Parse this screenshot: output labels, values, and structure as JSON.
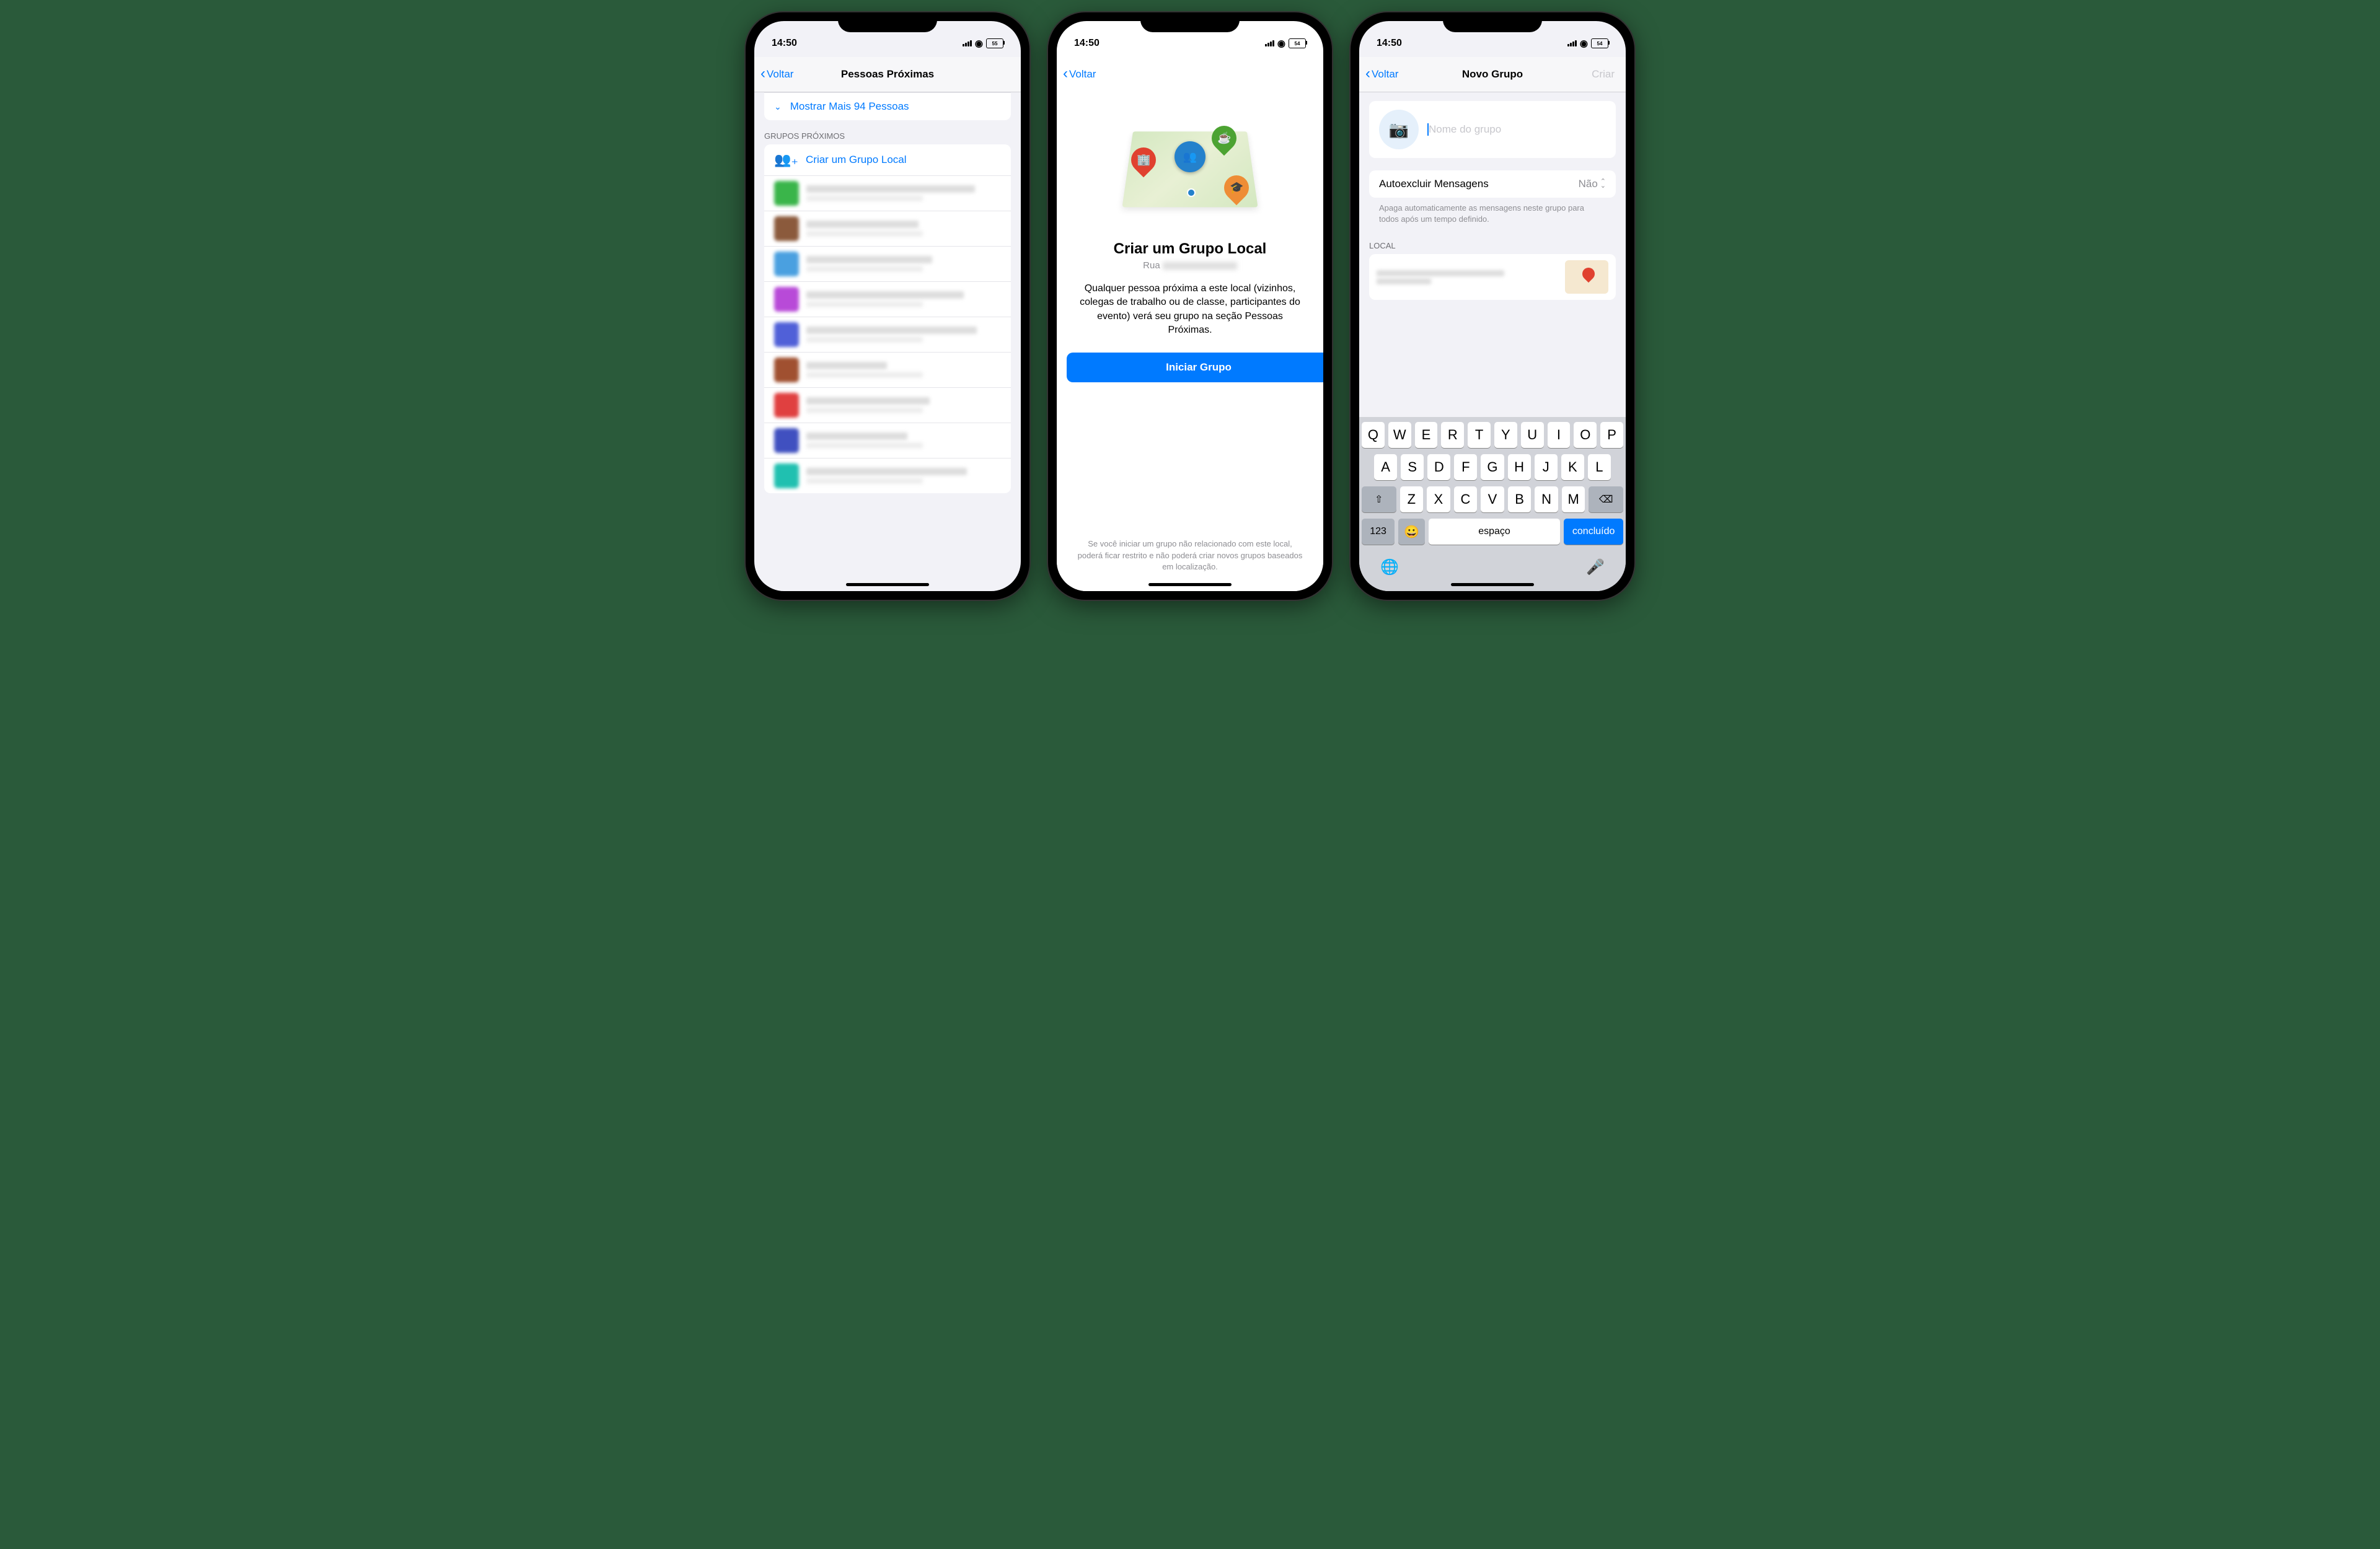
{
  "status": {
    "time": "14:50",
    "battery1": "55",
    "battery2": "54",
    "battery3": "54"
  },
  "nav": {
    "back": "Voltar",
    "title1": "Pessoas Próximas",
    "title3": "Novo Grupo",
    "create": "Criar"
  },
  "screen1": {
    "show_more": "Mostrar Mais 94 Pessoas",
    "section_groups": "GRUPOS PRÓXIMOS",
    "create_local": "Criar um Grupo Local"
  },
  "screen2": {
    "title": "Criar um Grupo Local",
    "street_prefix": "Rua",
    "desc": "Qualquer pessoa próxima a este local (vizinhos, colegas de trabalho ou de classe, participantes do evento) verá seu grupo na seção Pessoas Próximas.",
    "button": "Iniciar Grupo",
    "footer": "Se você iniciar um grupo não relacionado com este local, poderá ficar restrito e não poderá criar novos grupos baseados em localização."
  },
  "screen3": {
    "placeholder": "Nome do grupo",
    "autodelete_label": "Autoexcluir Mensagens",
    "autodelete_value": "Não",
    "autodelete_hint": "Apaga automaticamente as mensagens neste grupo para todos após um tempo definido.",
    "local_header": "LOCAL"
  },
  "keyboard": {
    "row1": [
      "Q",
      "W",
      "E",
      "R",
      "T",
      "Y",
      "U",
      "I",
      "O",
      "P"
    ],
    "row2": [
      "A",
      "S",
      "D",
      "F",
      "G",
      "H",
      "J",
      "K",
      "L"
    ],
    "row3": [
      "Z",
      "X",
      "C",
      "V",
      "B",
      "N",
      "M"
    ],
    "num": "123",
    "space": "espaço",
    "done": "concluído"
  },
  "avatars": [
    "#3ab54a",
    "#8b5a3c",
    "#4aa0e0",
    "#b84ad8",
    "#5060d8",
    "#a05030",
    "#e04040",
    "#4050c0",
    "#20c0b0"
  ]
}
